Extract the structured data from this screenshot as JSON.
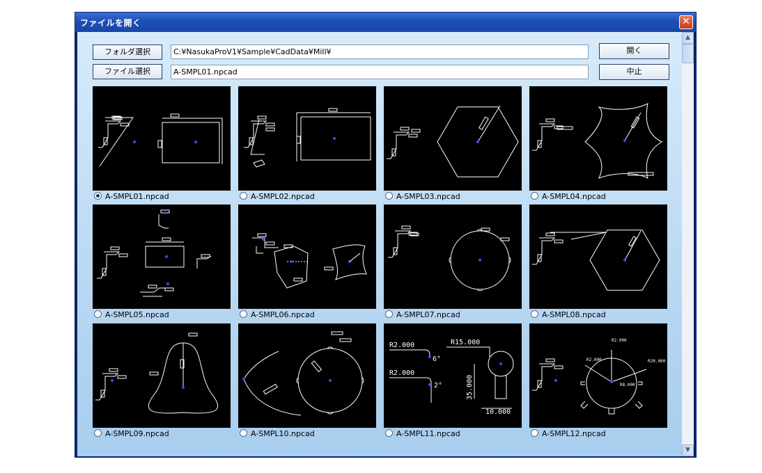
{
  "window": {
    "title": "ファイルを開く",
    "close_label": "✕"
  },
  "toolbar": {
    "folder_button": "フォルダ選択",
    "file_button": "ファイル選択",
    "folder_path": "C:¥NasukaProV1¥Sample¥CadData¥Mill¥",
    "file_name": "A-SMPL01.npcad",
    "open_button": "開く",
    "cancel_button": "中止"
  },
  "files": [
    {
      "name": "A-SMPL01.npcad",
      "selected": true
    },
    {
      "name": "A-SMPL02.npcad",
      "selected": false
    },
    {
      "name": "A-SMPL03.npcad",
      "selected": false
    },
    {
      "name": "A-SMPL04.npcad",
      "selected": false
    },
    {
      "name": "A-SMPL05.npcad",
      "selected": false
    },
    {
      "name": "A-SMPL06.npcad",
      "selected": false
    },
    {
      "name": "A-SMPL07.npcad",
      "selected": false
    },
    {
      "name": "A-SMPL08.npcad",
      "selected": false
    },
    {
      "name": "A-SMPL09.npcad",
      "selected": false
    },
    {
      "name": "A-SMPL10.npcad",
      "selected": false
    },
    {
      "name": "A-SMPL11.npcad",
      "selected": false
    },
    {
      "name": "A-SMPL12.npcad",
      "selected": false
    }
  ],
  "thumb11_labels": {
    "r1": "R2.000",
    "r2": "R2.000",
    "r3": "R15.000",
    "d1": "35.000",
    "d2": "10.000",
    "a1": "6°",
    "a2": "2°"
  },
  "thumb12_labels": {
    "a": "R2.000",
    "b": "R2.000",
    "c": "R8.000",
    "d": "R20.000"
  },
  "scrollbar": {
    "up_icon": "▲",
    "down_icon": "▼"
  },
  "colors": {
    "title_bar": "#1d4fb8",
    "panel": "#b8d8f2",
    "close": "#c8391e",
    "thumb_bg": "#000000",
    "cad_line": "#ffffff",
    "cad_center": "#3050ff"
  }
}
